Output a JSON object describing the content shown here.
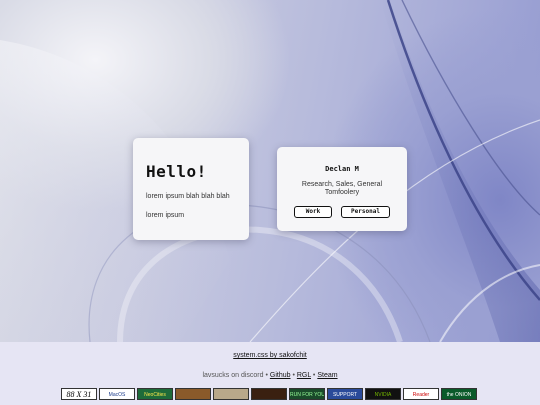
{
  "hello_card": {
    "title": "Hello!",
    "line1": "lorem ipsum blah blah blah",
    "line2": "lorem ipsum"
  },
  "profile_card": {
    "name": "Declan M",
    "description": "Research, Sales, General Tomfoolery",
    "work_label": "Work",
    "personal_label": "Personal"
  },
  "footer": {
    "credit": "system.css by sakofchit",
    "discord_prefix": "lavsucks on discord • ",
    "link_github": "Github",
    "sep1": " • ",
    "link_rgl": "RGL",
    "sep2": " • ",
    "link_steam": "Steam"
  },
  "badges": [
    {
      "label": "88 X 31",
      "bg": "#ffffff",
      "fg": "#000000",
      "icon": "88x31-badge"
    },
    {
      "label": "MacOS",
      "bg": "#ffffff",
      "fg": "#1a3a8a",
      "icon": "macos-badge"
    },
    {
      "label": "NeoCities",
      "bg": "#1e6b3a",
      "fg": "#ffe94a",
      "icon": "neocities-badge"
    },
    {
      "label": "",
      "bg": "#8a5a2a",
      "fg": "#ffd27a",
      "icon": "art-badge"
    },
    {
      "label": "",
      "bg": "#b8a88a",
      "fg": "#3a2a1a",
      "icon": "cartoon-badge"
    },
    {
      "label": "",
      "bg": "#3a2010",
      "fg": "#ff6a2a",
      "icon": "creature-badge"
    },
    {
      "label": "RUN FOR YOUR LIFE!",
      "bg": "#1a4a2a",
      "fg": "#9aff9a",
      "icon": "run-badge"
    },
    {
      "label": "SUPPORT",
      "bg": "#2a4a9a",
      "fg": "#ffffff",
      "icon": "support-badge"
    },
    {
      "label": "NVIDIA",
      "bg": "#111111",
      "fg": "#76b900",
      "icon": "nvidia-badge"
    },
    {
      "label": "Reader",
      "bg": "#ffffff",
      "fg": "#cc0000",
      "icon": "adobe-reader-badge"
    },
    {
      "label": "the ONION",
      "bg": "#0a5a2a",
      "fg": "#ffffff",
      "icon": "onion-badge"
    }
  ],
  "colors": {
    "footer_bg": "#e6e5f4",
    "card_bg": "#f6f6f8"
  }
}
